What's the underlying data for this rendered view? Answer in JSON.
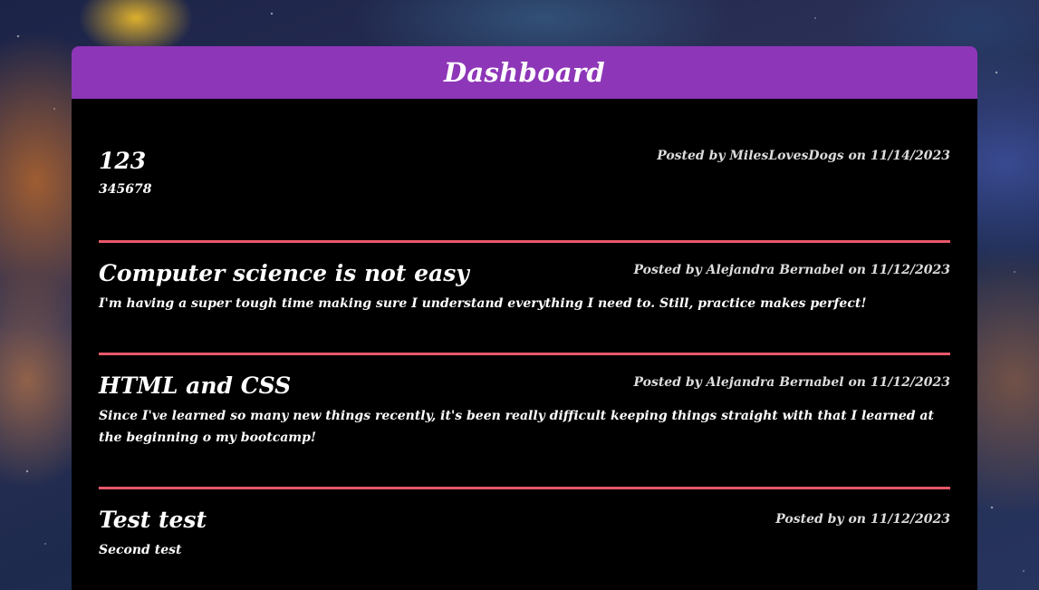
{
  "header": {
    "title": "Dashboard"
  },
  "posts": [
    {
      "title": "123",
      "meta": "Posted by MilesLovesDogs on 11/14/2023",
      "body": "345678"
    },
    {
      "title": "Computer science is not easy",
      "meta": "Posted by Alejandra Bernabel on 11/12/2023",
      "body": "I'm having a super tough time making sure I understand everything I need to. Still, practice makes perfect!"
    },
    {
      "title": "HTML and CSS",
      "meta": "Posted by Alejandra Bernabel on 11/12/2023",
      "body": "Since I've learned so many new things recently, it's been really difficult keeping things straight with that I learned at the beginning o my bootcamp!"
    },
    {
      "title": "Test test",
      "meta": "Posted by on 11/12/2023",
      "body": "Second test"
    }
  ],
  "colors": {
    "header_bg": "#8e36b8",
    "panel_bg": "#000000",
    "divider": "#e8586a"
  }
}
